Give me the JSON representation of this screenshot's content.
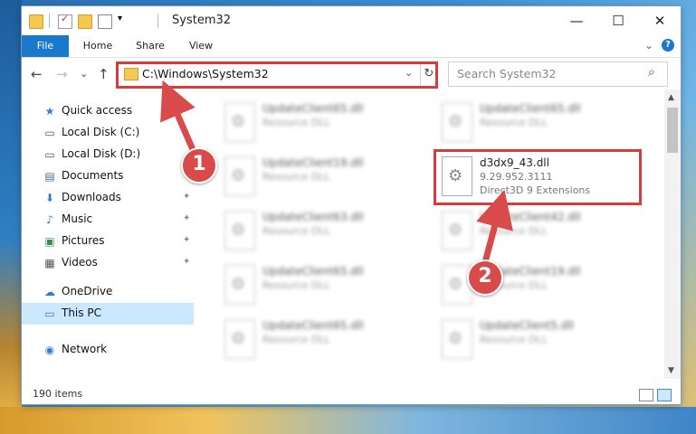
{
  "window": {
    "title": "System32",
    "controls": {
      "minimize": "—",
      "maximize": "☐",
      "close": "✕"
    }
  },
  "ribbon": {
    "tabs": [
      "File",
      "Home",
      "Share",
      "View"
    ],
    "expand_glyph": "⌄",
    "help_glyph": "?"
  },
  "nav": {
    "back": "←",
    "forward": "→",
    "recent": "⌄",
    "up": "↑",
    "address": "C:\\Windows\\System32",
    "address_dropdown": "⌄",
    "refresh": "↻",
    "search_placeholder": "Search System32",
    "search_icon_glyph": "⌕"
  },
  "sidebar": {
    "items": [
      {
        "label": "Quick access",
        "icon": "star-icon",
        "glyph": "★",
        "color": "#2d7fd3",
        "pinned": false
      },
      {
        "label": "Local Disk (C:)",
        "icon": "drive-icon",
        "glyph": "▭",
        "color": "#555555",
        "pinned": true
      },
      {
        "label": "Local Disk (D:)",
        "icon": "drive-icon",
        "glyph": "▭",
        "color": "#555555",
        "pinned": true
      },
      {
        "label": "Documents",
        "icon": "documents-icon",
        "glyph": "▤",
        "color": "#4a6b8a",
        "pinned": true
      },
      {
        "label": "Downloads",
        "icon": "download-icon",
        "glyph": "⬇",
        "color": "#2d7fd3",
        "pinned": true
      },
      {
        "label": "Music",
        "icon": "music-icon",
        "glyph": "♪",
        "color": "#2d7fd3",
        "pinned": true
      },
      {
        "label": "Pictures",
        "icon": "pictures-icon",
        "glyph": "▣",
        "color": "#3b8a5a",
        "pinned": true
      },
      {
        "label": "Videos",
        "icon": "videos-icon",
        "glyph": "▦",
        "color": "#555555",
        "pinned": true
      },
      {
        "label": "OneDrive",
        "icon": "cloud-icon",
        "glyph": "☁",
        "color": "#2d7fd3",
        "pinned": false
      },
      {
        "label": "This PC",
        "icon": "computer-icon",
        "glyph": "▭",
        "color": "#2d7fd3",
        "pinned": false,
        "selected": true
      },
      {
        "label": "Network",
        "icon": "network-icon",
        "glyph": "◉",
        "color": "#2d7fd3",
        "pinned": false
      }
    ],
    "pin_glyph": "📌"
  },
  "files": [
    {
      "name": "UpdateClient65.dll",
      "desc": "Resource DLL",
      "blurred": true
    },
    {
      "name": "UpdateClient65.dll",
      "desc": "Resource DLL",
      "blurred": true
    },
    {
      "name": "UpdateClient19.dll",
      "desc": "Resource DLL",
      "blurred": true
    },
    {
      "name": "d3dx9_43.dll",
      "desc": "9.29.952.3111",
      "desc2": "Direct3D 9 Extensions",
      "blurred": false
    },
    {
      "name": "UpdateClient63.dll",
      "desc": "Resource DLL",
      "blurred": true
    },
    {
      "name": "UpdateClient42.dll",
      "desc": "Resource DLL",
      "blurred": true
    },
    {
      "name": "UpdateClient65.dll",
      "desc": "Resource DLL",
      "blurred": true
    },
    {
      "name": "UpdateClient19.dll",
      "desc": "Resource DLL",
      "blurred": true
    },
    {
      "name": "UpdateClient65.dll",
      "desc": "Resource DLL",
      "blurred": true
    },
    {
      "name": "UpdateClient5.dll",
      "desc": "Resource DLL",
      "blurred": true
    }
  ],
  "status": {
    "item_count": "190 items"
  },
  "annotations": {
    "step1": "1",
    "step2": "2",
    "highlight_color": "#d83b3b"
  },
  "colors": {
    "accent": "#1979ca",
    "selection": "#cce8ff",
    "annotation": "#d94a4a"
  }
}
